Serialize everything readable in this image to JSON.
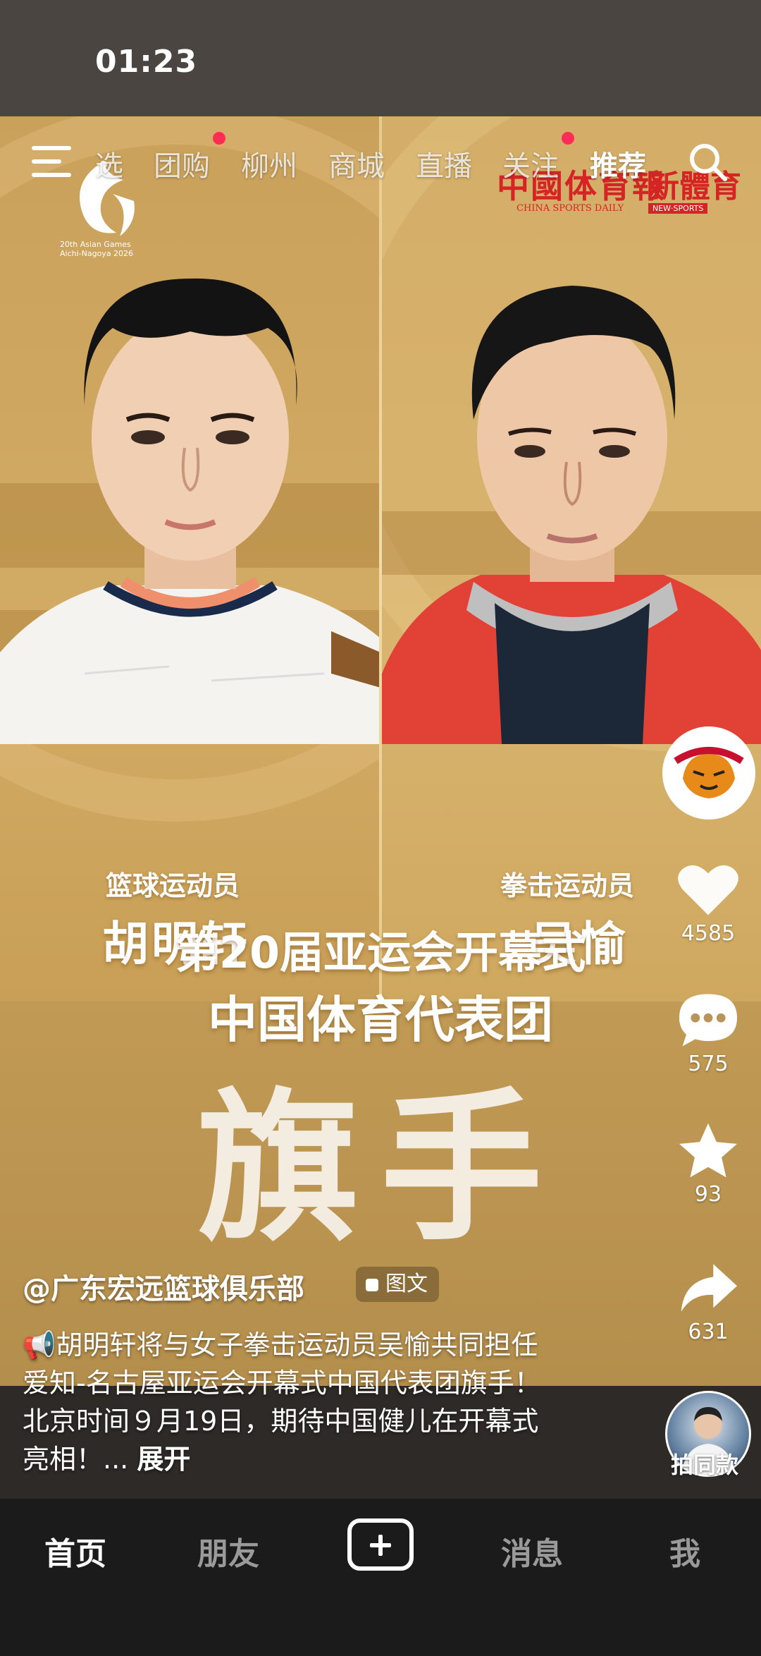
{
  "status_bar": {
    "time": "01:23"
  },
  "top_nav": {
    "tabs": [
      {
        "label": "选",
        "active": false,
        "dot": false
      },
      {
        "label": "团购",
        "active": false,
        "dot": true
      },
      {
        "label": "柳州",
        "active": false,
        "dot": false
      },
      {
        "label": "商城",
        "active": false,
        "dot": false
      },
      {
        "label": "直播",
        "active": false,
        "dot": false
      },
      {
        "label": "关注",
        "active": false,
        "dot": true
      },
      {
        "label": "推荐",
        "active": true,
        "dot": false
      }
    ],
    "menu_icon": "hamburger-icon",
    "search_icon": "search-icon"
  },
  "poster": {
    "logo_asian_games": {
      "line1": "20th Asian Games",
      "line2": "Aichi-Nagoya 2026"
    },
    "logo_china_sports_daily": {
      "name": "中國体育報",
      "sub": "CHINA SPORTS DAILY"
    },
    "logo_new_sports": {
      "name": "新體育",
      "sub": "NEW·SPORTS"
    },
    "left_athlete": {
      "role": "篮球运动员",
      "name": "胡明轩"
    },
    "right_athlete": {
      "role": "拳击运动员",
      "name": "吴愉"
    },
    "headline_line1": "第20届亚运会开幕式",
    "headline_line2": "中国体育代表团",
    "headline_big": "旗手"
  },
  "side_actions": {
    "like_count": "4585",
    "comment_count": "575",
    "favorite_count": "93",
    "share_count": "631"
  },
  "post": {
    "author": "@广东宏远篮球俱乐部",
    "type_tag": "图文",
    "caption_lines": [
      "📢胡明轩将与女子拳击运动员吴愉共同担任",
      "爱知-名古屋亚运会开幕式中国代表团旗手！",
      "北京时间９月19日，期待中国健儿在开幕式",
      "亮相！..."
    ],
    "expand_label": "展开",
    "same_style_label": "拍同款"
  },
  "bottom_tabs": [
    {
      "label": "首页",
      "active": true
    },
    {
      "label": "朋友",
      "active": false
    },
    {
      "label": "消息",
      "active": false
    },
    {
      "label": "我",
      "active": false
    }
  ],
  "colors": {
    "poster_gold": "#c79f56",
    "accent_red": "#ff2d55",
    "logo_red": "#d42424",
    "bottom_bar": "#1b1b1b"
  }
}
